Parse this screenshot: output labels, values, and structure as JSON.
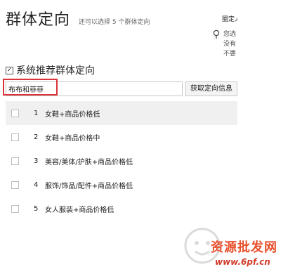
{
  "header": {
    "title": "群体定向",
    "subtitle": "还可以选择 5 个群体定向"
  },
  "side_panel": {
    "title": "圈定人群",
    "lines": [
      "您选",
      "没有",
      "不要"
    ]
  },
  "system_recommend": {
    "checked": true,
    "check_mark": "✓",
    "label": "系统推荐群体定向"
  },
  "search": {
    "value": "布布和菲菲",
    "button_label": "获取定向信息"
  },
  "groups": [
    {
      "num": "1",
      "label": "女鞋+商品价格低"
    },
    {
      "num": "2",
      "label": "女鞋+商品价格中"
    },
    {
      "num": "3",
      "label": "美容/美体/护肤+商品价格低"
    },
    {
      "num": "4",
      "label": "服饰/饰品/配件+商品价格低"
    },
    {
      "num": "5",
      "label": "女人服装+商品价格低"
    }
  ],
  "watermark": {
    "text": "资源批发网",
    "url": "www.6pf.cn"
  },
  "colors": {
    "highlight_outline": "#d9343b",
    "row_highlight": "#f0f0f0",
    "watermark": "#e84f2a"
  }
}
